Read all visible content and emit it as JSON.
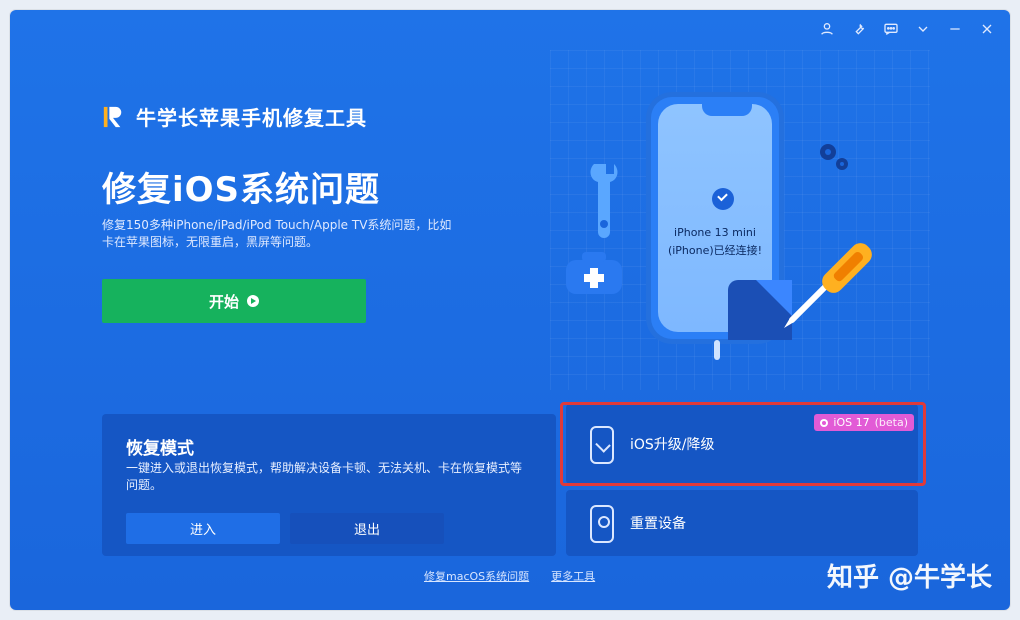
{
  "app": {
    "brand_name": "牛学长苹果手机修复工具"
  },
  "hero": {
    "title": "修复iOS系统问题",
    "description": "修复150多种iPhone/iPad/iPod Touch/Apple TV系统问题，比如卡在苹果图标，无限重启，黑屏等问题。",
    "start_button": "开始"
  },
  "device": {
    "line1": "iPhone 13 mini",
    "line2": "(iPhone)已经连接!"
  },
  "recovery_mode": {
    "title": "恢复模式",
    "description": "一键进入或退出恢复模式，帮助解决设备卡顿、无法关机、卡在恢复模式等问题。",
    "enter_label": "进入",
    "exit_label": "退出"
  },
  "features": {
    "upgrade_label": "iOS升级/降级",
    "badge_text": "iOS 17",
    "badge_beta": "(beta)",
    "reset_label": "重置设备"
  },
  "footer": {
    "mac_link": "修复macOS系统问题",
    "more_tools": "更多工具"
  },
  "watermark": "知乎 @牛学长",
  "colors": {
    "window_bg": "#1f73e8",
    "start_green": "#16b25d",
    "highlight_red": "#e03a3a",
    "badge_pink": "#e25bd6"
  }
}
